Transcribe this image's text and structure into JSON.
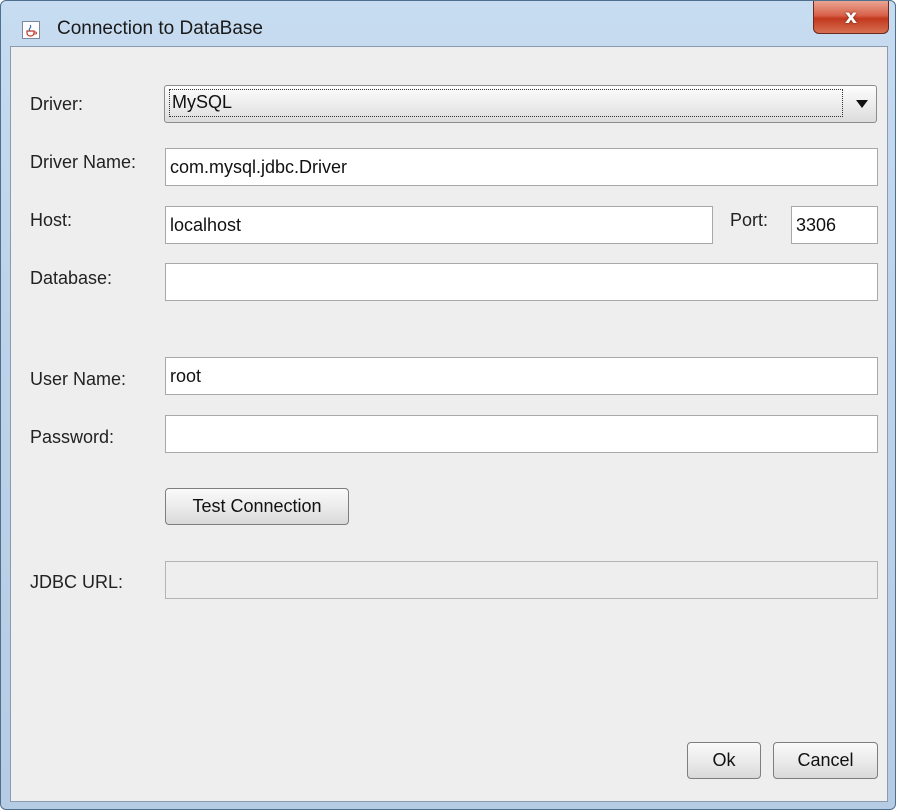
{
  "window": {
    "title": "Connection to DataBase",
    "close_label": "x"
  },
  "form": {
    "driver_label": "Driver:",
    "driver_value": "MySQL",
    "driver_name_label": "Driver Name:",
    "driver_name_value": "com.mysql.jdbc.Driver",
    "host_label": "Host:",
    "host_value": "localhost",
    "port_label": "Port:",
    "port_value": "3306",
    "database_label": "Database:",
    "database_value": "",
    "user_name_label": "User Name:",
    "user_name_value": "root",
    "password_label": "Password:",
    "password_value": "",
    "jdbc_url_label": "JDBC URL:",
    "jdbc_url_value": ""
  },
  "buttons": {
    "test_connection": "Test Connection",
    "ok": "Ok",
    "cancel": "Cancel"
  },
  "icons": {
    "app": "java-cup-icon",
    "close": "close-icon",
    "dropdown": "chevron-down-icon"
  },
  "colors": {
    "titlebar": "#bdd3ea",
    "close_button": "#c2391f",
    "panel_background": "#eeeeee"
  }
}
